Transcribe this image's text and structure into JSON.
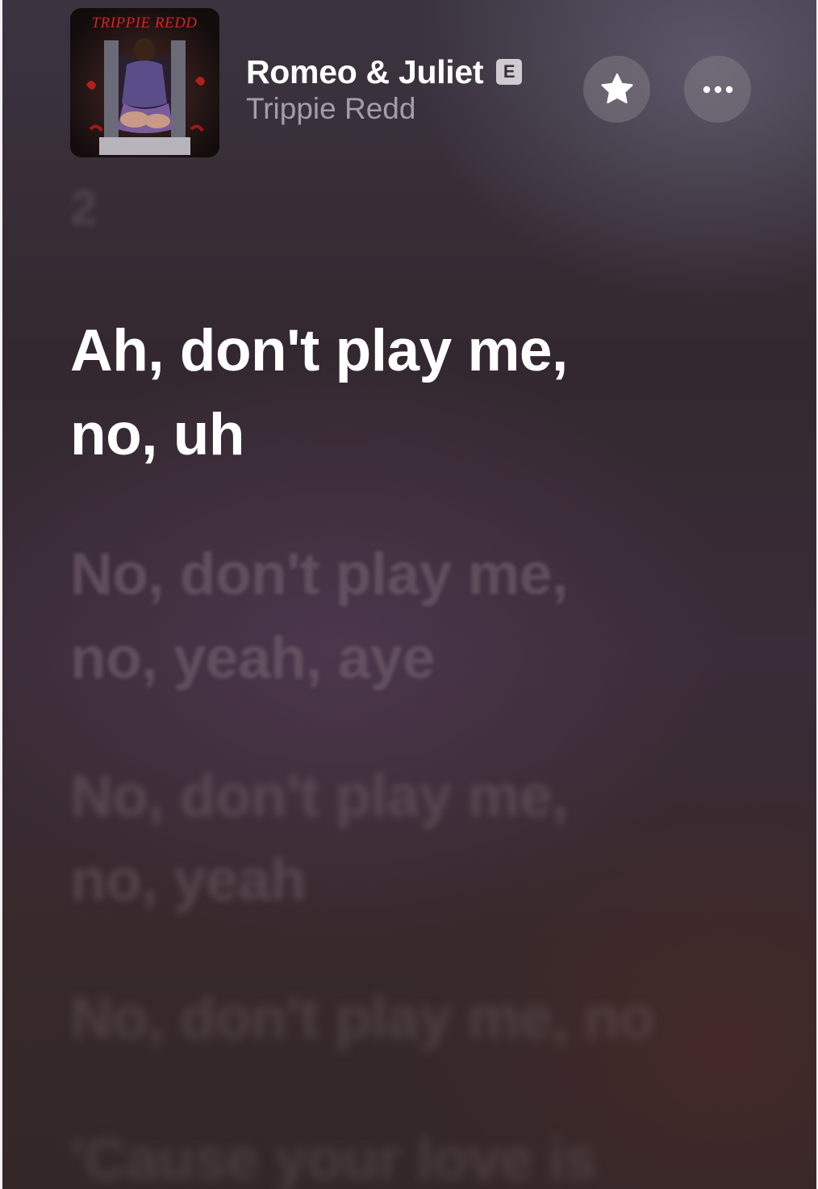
{
  "now_playing": {
    "song_title": "Romeo & Juliet",
    "explicit_badge": "E",
    "artist": "Trippie Redd",
    "album_art_text": "TRIPPIE REDD",
    "favorite_icon": "star-icon",
    "more_icon": "ellipsis-icon"
  },
  "lyrics": {
    "previous": "2",
    "current": "Ah, don't play me,\nno, uh",
    "upcoming": [
      "No, don't play me,\nno, yeah, aye",
      "No, don't play me,\nno, yeah",
      "No, don't play me, no",
      "'Cause your love is"
    ]
  },
  "colors": {
    "background_top": "#3b3440",
    "background_bottom": "#33272a",
    "active_lyric": "#ffffff",
    "inactive_lyric": "#786672",
    "button_fill": "#807a84"
  }
}
